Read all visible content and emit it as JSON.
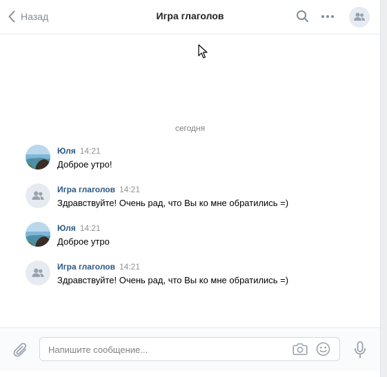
{
  "header": {
    "back_label": "Назад",
    "title": "Игра глаголов"
  },
  "chat": {
    "date_separator": "сегодня",
    "messages": [
      {
        "author": "Юля",
        "time": "14:21",
        "text": "Доброе утро!",
        "avatar": "photo"
      },
      {
        "author": "Игра глаголов",
        "time": "14:21",
        "text": "Здравствуйте! Очень рад, что Вы ко мне обратились =)",
        "avatar": "group"
      },
      {
        "author": "Юля",
        "time": "14:21",
        "text": "Доброе утро",
        "avatar": "photo"
      },
      {
        "author": "Игра глаголов",
        "time": "14:21",
        "text": "Здравствуйте! Очень рад, что Вы ко мне обратились =)",
        "avatar": "group"
      }
    ]
  },
  "composer": {
    "placeholder": "Напишите сообщение...",
    "value": ""
  },
  "icons": {
    "back": "chevron-left-icon",
    "search": "search-icon",
    "more": "more-horizontal-icon",
    "group_avatar": "users-icon",
    "attach": "paperclip-icon",
    "camera": "camera-icon",
    "emoji": "smile-icon",
    "mic": "microphone-icon"
  },
  "colors": {
    "link": "#2a5885",
    "muted": "#818c99",
    "avatar_bg": "#e5ebf1"
  }
}
